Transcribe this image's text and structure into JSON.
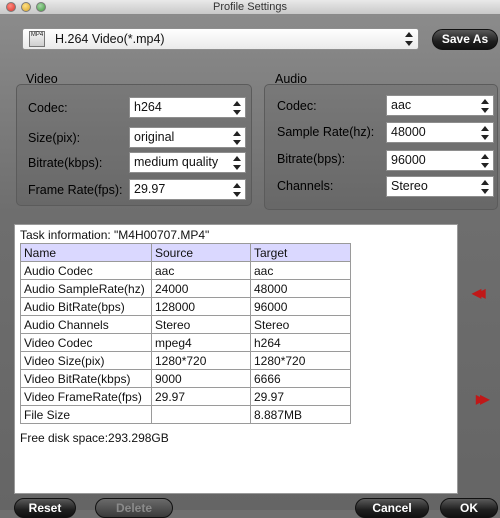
{
  "window": {
    "title": "Profile Settings"
  },
  "format": {
    "icon_text": "MP4",
    "selected": "H.264 Video(*.mp4)"
  },
  "toolbar": {
    "save_as": "Save As"
  },
  "video": {
    "title": "Video",
    "codec": {
      "label": "Codec:",
      "value": "h264"
    },
    "size": {
      "label": "Size(pix):",
      "value": "original"
    },
    "bitrate": {
      "label": "Bitrate(kbps):",
      "value": "medium quality"
    },
    "framerate": {
      "label": "Frame Rate(fps):",
      "value": "29.97"
    }
  },
  "audio": {
    "title": "Audio",
    "codec": {
      "label": "Codec:",
      "value": "aac"
    },
    "samplerate": {
      "label": "Sample Rate(hz):",
      "value": "48000"
    },
    "bitrate": {
      "label": "Bitrate(bps):",
      "value": "96000"
    },
    "channels": {
      "label": "Channels:",
      "value": "Stereo"
    }
  },
  "task": {
    "info": "Task information: \"M4H00707.MP4\"",
    "headers": [
      "Name",
      "Source",
      "Target"
    ],
    "rows": [
      [
        "Audio Codec",
        "aac",
        "aac"
      ],
      [
        "Audio SampleRate(hz)",
        "24000",
        "48000"
      ],
      [
        "Audio BitRate(bps)",
        "128000",
        "96000"
      ],
      [
        "Audio Channels",
        "Stereo",
        "Stereo"
      ],
      [
        "Video Codec",
        "mpeg4",
        "h264"
      ],
      [
        "Video Size(pix)",
        "1280*720",
        "1280*720"
      ],
      [
        "Video BitRate(kbps)",
        "9000",
        "6666"
      ],
      [
        "Video FrameRate(fps)",
        "29.97",
        "29.97"
      ],
      [
        "File Size",
        "",
        "8.887MB"
      ]
    ],
    "free_space": "Free disk space:293.298GB"
  },
  "side_arrows": {
    "left": "◀◀",
    "right": "▶▶"
  },
  "buttons": {
    "reset": "Reset",
    "delete": "Delete",
    "cancel": "Cancel",
    "ok": "OK"
  },
  "colors": {
    "accent_header": "#dad8ff",
    "arrow_red": "#c01818"
  }
}
